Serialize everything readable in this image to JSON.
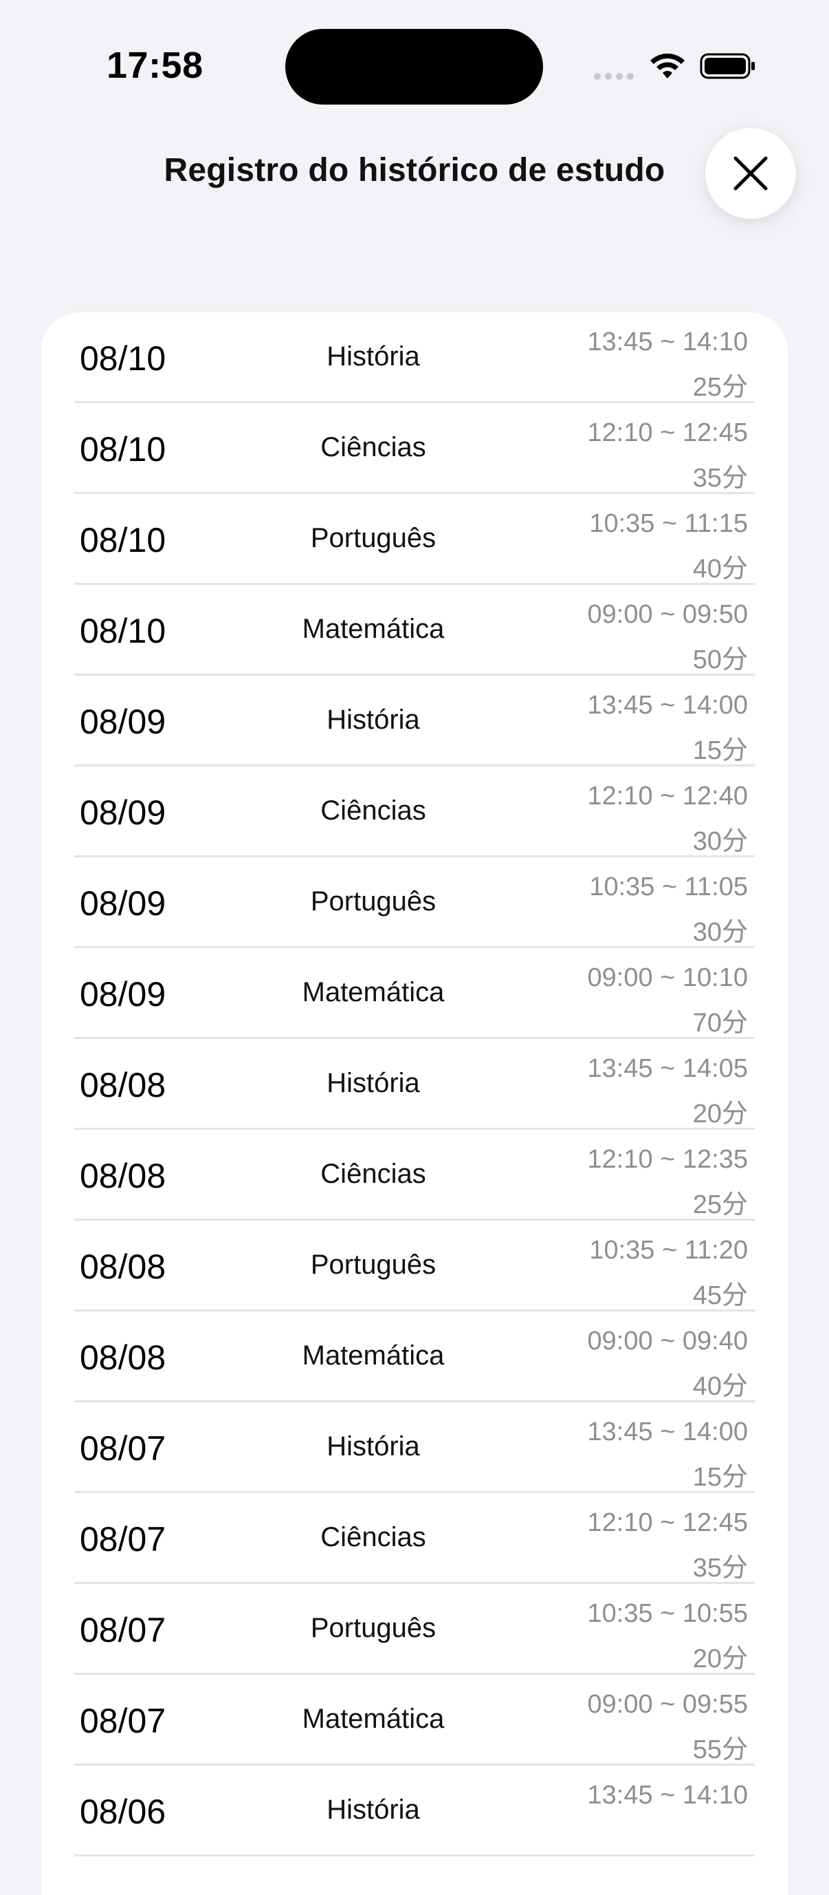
{
  "status_bar": {
    "time": "17:58"
  },
  "header": {
    "title": "Registro do histórico de estudo"
  },
  "records": [
    {
      "date": "08/10",
      "subject": "História",
      "range": "13:45 ~ 14:10",
      "duration": "25分"
    },
    {
      "date": "08/10",
      "subject": "Ciências",
      "range": "12:10 ~ 12:45",
      "duration": "35分"
    },
    {
      "date": "08/10",
      "subject": "Português",
      "range": "10:35 ~ 11:15",
      "duration": "40分"
    },
    {
      "date": "08/10",
      "subject": "Matemática",
      "range": "09:00 ~ 09:50",
      "duration": "50分"
    },
    {
      "date": "08/09",
      "subject": "História",
      "range": "13:45 ~ 14:00",
      "duration": "15分"
    },
    {
      "date": "08/09",
      "subject": "Ciências",
      "range": "12:10 ~ 12:40",
      "duration": "30分"
    },
    {
      "date": "08/09",
      "subject": "Português",
      "range": "10:35 ~ 11:05",
      "duration": "30分"
    },
    {
      "date": "08/09",
      "subject": "Matemática",
      "range": "09:00 ~ 10:10",
      "duration": "70分"
    },
    {
      "date": "08/08",
      "subject": "História",
      "range": "13:45 ~ 14:05",
      "duration": "20分"
    },
    {
      "date": "08/08",
      "subject": "Ciências",
      "range": "12:10 ~ 12:35",
      "duration": "25分"
    },
    {
      "date": "08/08",
      "subject": "Português",
      "range": "10:35 ~ 11:20",
      "duration": "45分"
    },
    {
      "date": "08/08",
      "subject": "Matemática",
      "range": "09:00 ~ 09:40",
      "duration": "40分"
    },
    {
      "date": "08/07",
      "subject": "História",
      "range": "13:45 ~ 14:00",
      "duration": "15分"
    },
    {
      "date": "08/07",
      "subject": "Ciências",
      "range": "12:10 ~ 12:45",
      "duration": "35分"
    },
    {
      "date": "08/07",
      "subject": "Português",
      "range": "10:35 ~ 10:55",
      "duration": "20分"
    },
    {
      "date": "08/07",
      "subject": "Matemática",
      "range": "09:00 ~ 09:55",
      "duration": "55分"
    },
    {
      "date": "08/06",
      "subject": "História",
      "range": "13:45 ~ 14:10",
      "duration": ""
    }
  ],
  "icons": {
    "close": "close-icon",
    "wifi": "wifi-icon",
    "battery": "battery-icon"
  }
}
